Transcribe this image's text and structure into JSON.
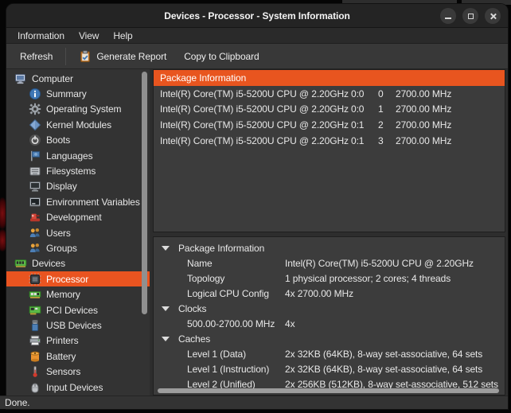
{
  "window": {
    "title": "Devices - Processor - System Information",
    "controls": [
      {
        "name": "minimize-button",
        "icon": "minimize-icon"
      },
      {
        "name": "maximize-button",
        "icon": "maximize-icon"
      },
      {
        "name": "close-button",
        "icon": "close-icon"
      }
    ]
  },
  "menu": {
    "items": [
      "Information",
      "View",
      "Help"
    ]
  },
  "toolbar": {
    "refresh": "Refresh",
    "generate_report": "Generate Report",
    "generate_report_icon": "clipboard-icon",
    "copy_to_clipboard": "Copy to Clipboard"
  },
  "sidebar": {
    "items": [
      {
        "label": "Computer",
        "icon": "computer-icon",
        "level": 0,
        "selected": false
      },
      {
        "label": "Summary",
        "icon": "summary-info-icon",
        "level": 1,
        "selected": false
      },
      {
        "label": "Operating System",
        "icon": "gear-icon",
        "level": 1,
        "selected": false
      },
      {
        "label": "Kernel Modules",
        "icon": "kernel-modules-icon",
        "level": 1,
        "selected": false
      },
      {
        "label": "Boots",
        "icon": "power-icon",
        "level": 1,
        "selected": false
      },
      {
        "label": "Languages",
        "icon": "flag-icon",
        "level": 1,
        "selected": false
      },
      {
        "label": "Filesystems",
        "icon": "filesystems-icon",
        "level": 1,
        "selected": false
      },
      {
        "label": "Display",
        "icon": "display-icon",
        "level": 1,
        "selected": false
      },
      {
        "label": "Environment Variables",
        "icon": "terminal-icon",
        "level": 1,
        "selected": false
      },
      {
        "label": "Development",
        "icon": "development-icon",
        "level": 1,
        "selected": false
      },
      {
        "label": "Users",
        "icon": "users-icon",
        "level": 1,
        "selected": false
      },
      {
        "label": "Groups",
        "icon": "groups-icon",
        "level": 1,
        "selected": false
      },
      {
        "label": "Devices",
        "icon": "devices-chip-icon",
        "level": 0,
        "selected": false
      },
      {
        "label": "Processor",
        "icon": "processor-icon",
        "level": 1,
        "selected": true
      },
      {
        "label": "Memory",
        "icon": "memory-icon",
        "level": 1,
        "selected": false
      },
      {
        "label": "PCI Devices",
        "icon": "pci-devices-icon",
        "level": 1,
        "selected": false
      },
      {
        "label": "USB Devices",
        "icon": "usb-devices-icon",
        "level": 1,
        "selected": false
      },
      {
        "label": "Printers",
        "icon": "printer-icon",
        "level": 1,
        "selected": false
      },
      {
        "label": "Battery",
        "icon": "battery-icon",
        "level": 1,
        "selected": false
      },
      {
        "label": "Sensors",
        "icon": "sensors-thermometer-icon",
        "level": 1,
        "selected": false
      },
      {
        "label": "Input Devices",
        "icon": "mouse-icon",
        "level": 1,
        "selected": false
      }
    ]
  },
  "cpu_table": {
    "header": "Package Information",
    "rows": [
      {
        "name": "Intel(R) Core(TM) i5-5200U CPU @ 2.20GHz",
        "socket": "0:0",
        "core": "0",
        "frequency": "2700.00 MHz"
      },
      {
        "name": "Intel(R) Core(TM) i5-5200U CPU @ 2.20GHz",
        "socket": "0:0",
        "core": "1",
        "frequency": "2700.00 MHz"
      },
      {
        "name": "Intel(R) Core(TM) i5-5200U CPU @ 2.20GHz",
        "socket": "0:1",
        "core": "2",
        "frequency": "2700.00 MHz"
      },
      {
        "name": "Intel(R) Core(TM) i5-5200U CPU @ 2.20GHz",
        "socket": "0:1",
        "core": "3",
        "frequency": "2700.00 MHz"
      }
    ]
  },
  "details": {
    "rows": [
      {
        "type": "section",
        "label": "Package Information"
      },
      {
        "type": "kv",
        "label": "Name",
        "value": "Intel(R) Core(TM) i5-5200U CPU @ 2.20GHz"
      },
      {
        "type": "kv",
        "label": "Topology",
        "value": "1 physical processor; 2 cores; 4 threads"
      },
      {
        "type": "kv",
        "label": "Logical CPU Config",
        "value": "4x 2700.00 MHz"
      },
      {
        "type": "section",
        "label": "Clocks"
      },
      {
        "type": "kv",
        "label": "500.00-2700.00 MHz",
        "value": "4x"
      },
      {
        "type": "section",
        "label": "Caches"
      },
      {
        "type": "kv",
        "label": "Level 1 (Data)",
        "value": "2x 32KB (64KB), 8-way set-associative, 64 sets"
      },
      {
        "type": "kv",
        "label": "Level 1 (Instruction)",
        "value": "2x 32KB (64KB), 8-way set-associative, 64 sets"
      },
      {
        "type": "kv",
        "label": "Level 2 (Unified)",
        "value": "2x 256KB (512KB), 8-way set-associative, 512 sets"
      }
    ]
  },
  "statusbar": {
    "text": "Done."
  },
  "colors": {
    "accent_orange": "#e95420",
    "titlebar": "#242424",
    "panel": "#3c3c3c",
    "sidebar": "#333333"
  }
}
